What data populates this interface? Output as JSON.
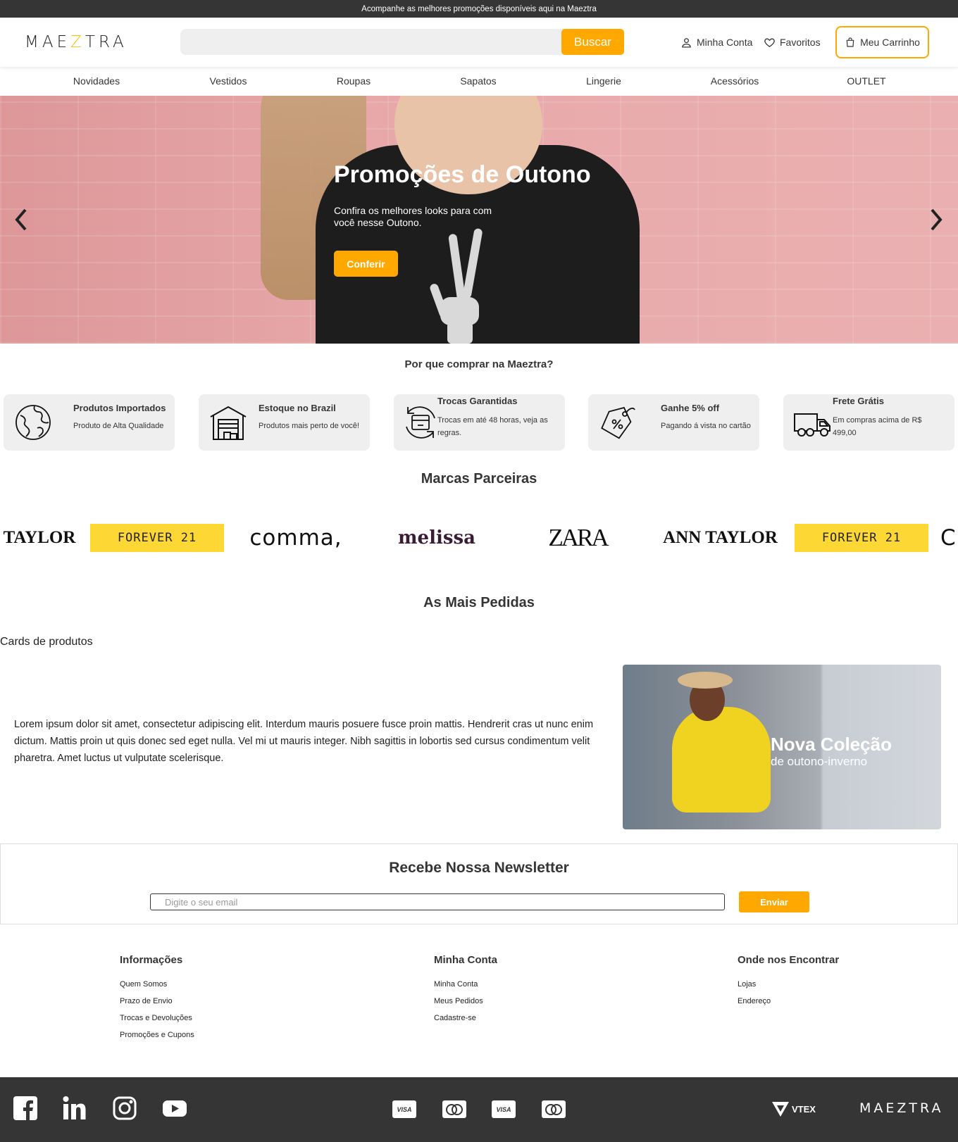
{
  "topbar": {
    "text": "Acompanhe as melhores promoções disponíveis aqui na Maeztra"
  },
  "header": {
    "logo": {
      "pre": "MAE",
      "z": "Z",
      "post": "TRA"
    },
    "search": {
      "placeholder": "",
      "button": "Buscar"
    },
    "account": "Minha Conta",
    "favorites": "Favoritos",
    "cart": "Meu Carrinho"
  },
  "nav": [
    "Novidades",
    "Vestidos",
    "Roupas",
    "Sapatos",
    "Lingerie",
    "Acessórios",
    "OUTLET"
  ],
  "hero": {
    "title": "Promoções de Outono",
    "subtitle": "Confira os melhores looks para com você nesse Outono.",
    "button": "Conferir"
  },
  "why": {
    "title": "Por que comprar na Maeztra?",
    "items": [
      {
        "title": "Produtos Importados",
        "desc": "Produto de Alta Qualidade",
        "icon": "globe-icon"
      },
      {
        "title": "Estoque no Brazil",
        "desc": "Produtos mais perto de você!",
        "icon": "warehouse-icon"
      },
      {
        "title": "Trocas Garantidas",
        "desc": "Trocas em até 48 horas, veja as regras.",
        "icon": "exchange-box-icon"
      },
      {
        "title": "Ganhe 5% off",
        "desc": "Pagando á vista no cartão",
        "icon": "discount-tag-icon"
      },
      {
        "title": "Frete Grátis",
        "desc": "Em compras acima de R$ 499,00",
        "icon": "truck-icon"
      }
    ]
  },
  "brands": {
    "title": "Marcas Parceiras",
    "items": [
      "TAYLOR",
      "FOREVER 21",
      "comma,",
      "melissa",
      "ZARA",
      "ANN TAYLOR",
      "FOREVER 21",
      "C"
    ]
  },
  "bestsellers": {
    "title": "As Mais Pedidas",
    "cards_label": "Cards de produtos"
  },
  "about": {
    "text": "Lorem ipsum dolor sit amet, consectetur adipiscing elit. Interdum mauris posuere fusce proin mattis. Hendrerit cras ut nunc enim dictum. Mattis proin ut quis donec sed eget nulla. Vel mi ut mauris integer. Nibh sagittis in lobortis sed cursus condimentum velit pharetra. Amet luctus ut vulputate scelerisque.",
    "promo_title": "Nova Coleção",
    "promo_subtitle": "de outono-inverno"
  },
  "newsletter": {
    "title": "Recebe Nossa Newsletter",
    "placeholder": "Digite o seu email",
    "button": "Enviar"
  },
  "footer": {
    "columns": [
      {
        "title": "Informações",
        "links": [
          "Quem Somos",
          "Prazo de Envio",
          "Trocas e Devoluções",
          "Promoções e Cupons"
        ]
      },
      {
        "title": "Minha Conta",
        "links": [
          "Minha Conta",
          "Meus Pedidos",
          "Cadastre-se"
        ]
      },
      {
        "title": "Onde nos Encontrar",
        "links": [
          "Lojas",
          "Endereço"
        ]
      }
    ],
    "social": [
      "facebook-icon",
      "linkedin-icon",
      "instagram-icon",
      "youtube-icon"
    ],
    "payments": [
      "VISA",
      "mastercard",
      "VISA",
      "mastercard"
    ],
    "vtex": "VTEX",
    "logo": "MAEZTRA"
  },
  "colors": {
    "accent": "#ffa800",
    "dark": "#353535",
    "logo_z": "#f7c300",
    "forever21": "#fdd835"
  }
}
